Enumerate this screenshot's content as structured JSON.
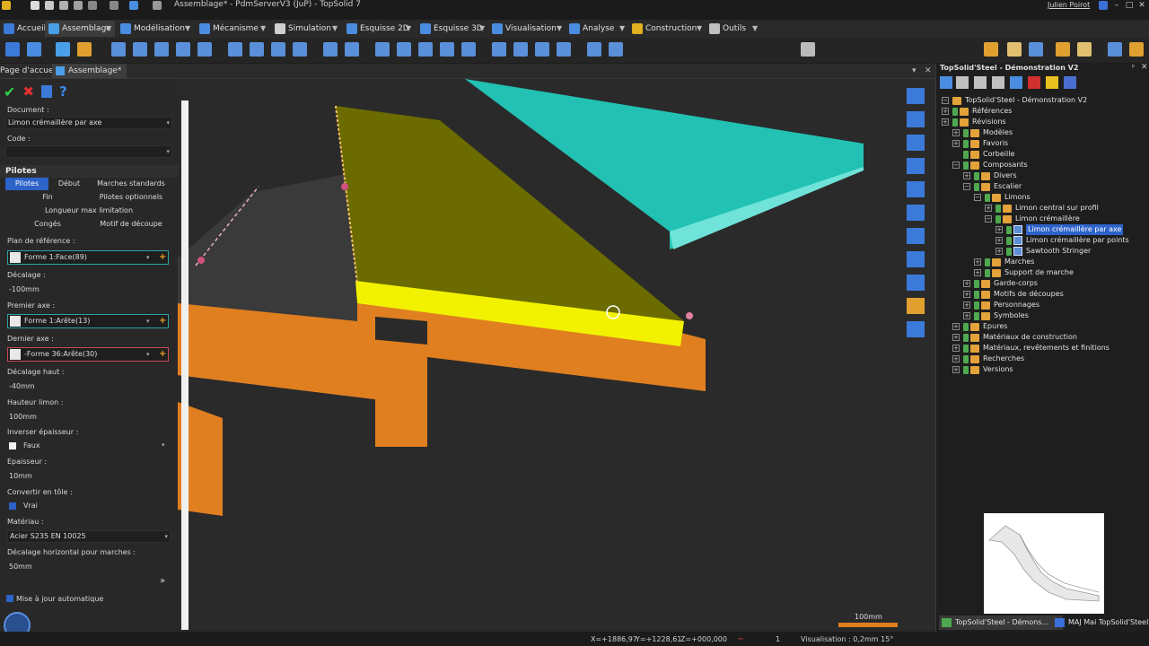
{
  "window": {
    "title": "Assemblage* - PdmServerV3 (JuP) - TopSolid 7",
    "user": "Julien Poirot",
    "minimize": "–",
    "maximize": "□",
    "close": "✕"
  },
  "menu": {
    "items": [
      {
        "label": "Accueil"
      },
      {
        "label": "Assemblage"
      },
      {
        "label": "Modélisation"
      },
      {
        "label": "Mécanisme"
      },
      {
        "label": "Simulation"
      },
      {
        "label": "Esquisse 2D"
      },
      {
        "label": "Esquisse 3D"
      },
      {
        "label": "Visualisation"
      },
      {
        "label": "Analyse"
      },
      {
        "label": "Construction"
      },
      {
        "label": "Outils"
      }
    ],
    "caret": "▼"
  },
  "tabs": {
    "home": "Page d'accueil",
    "assembly": "Assemblage*",
    "pin": "▾",
    "close": "✕"
  },
  "panel": {
    "ok_icon": "✔",
    "cancel_icon": "✖",
    "help_icon": "?",
    "document_label": "Document :",
    "document_value": "Limon crémaillère par axe",
    "code_label": "Code :",
    "code_value": "",
    "section_title": "Pilotes",
    "pilot_tabs": [
      "Pilotes",
      "Début",
      "Marches standards",
      "Fin",
      "Pilotes optionnels",
      "Longueur max limitation",
      "Congés",
      "Motif de découpe"
    ],
    "plan_label": "Plan de référence :",
    "plan_value": "Forme 1:Face(89)",
    "offset_label": "Décalage :",
    "offset_value": "-100mm",
    "first_axis_label": "Premier axe :",
    "first_axis_value": "Forme 1:Arête(13)",
    "last_axis_label": "Dernier axe :",
    "last_axis_value": "-Forme 36:Arête(30)",
    "top_offset_label": "Décalage haut :",
    "top_offset_value": "-40mm",
    "height_label": "Hauteur limon :",
    "height_value": "100mm",
    "invert_label": "Inverser épaisseur :",
    "invert_value": "Faux",
    "thickness_label": "Epaisseur :",
    "thickness_value": "10mm",
    "sheet_label": "Convertir en tôle :",
    "sheet_value": "Vrai",
    "material_label": "Matériau :",
    "material_value": "Acier S235 EN 10025",
    "h_offset_label": "Décalage horizontal pour marches :",
    "h_offset_value": "50mm",
    "more": "»",
    "auto_update": "Mise à jour automatique",
    "dropdown": "▾",
    "plus": "+"
  },
  "viewport": {
    "scale_label": "100mm",
    "colors": {
      "olive": "#6f6f00",
      "yellow": "#f5f500",
      "orange": "#e08020",
      "cyan": "#23c4b8",
      "gray": "#3c3c3c"
    }
  },
  "tree": {
    "title": "TopSolid'Steel - Démonstration V2",
    "pin": "ᵖ",
    "close": "✕",
    "expand": "+",
    "collapse": "−",
    "items": [
      {
        "label": "TopSolid'Steel - Démonstration V2",
        "depth": 0,
        "exp": "−",
        "kind": "root"
      },
      {
        "label": "Références",
        "depth": 0,
        "exp": "+",
        "kind": "folder"
      },
      {
        "label": "Révisions",
        "depth": 0,
        "exp": "+",
        "kind": "folder"
      },
      {
        "label": "Modèles",
        "depth": 1,
        "exp": "+",
        "kind": "folder"
      },
      {
        "label": "Favoris",
        "depth": 1,
        "exp": "+",
        "kind": "folder"
      },
      {
        "label": "Corbeille",
        "depth": 1,
        "exp": "",
        "kind": "folder"
      },
      {
        "label": "Composants",
        "depth": 1,
        "exp": "−",
        "kind": "folder"
      },
      {
        "label": "Divers",
        "depth": 2,
        "exp": "+",
        "kind": "folder"
      },
      {
        "label": "Escalier",
        "depth": 2,
        "exp": "−",
        "kind": "folder"
      },
      {
        "label": "Limons",
        "depth": 3,
        "exp": "−",
        "kind": "folder"
      },
      {
        "label": "Limon central sur profil",
        "depth": 4,
        "exp": "+",
        "kind": "folder"
      },
      {
        "label": "Limon crémaillère",
        "depth": 4,
        "exp": "−",
        "kind": "folder"
      },
      {
        "label": "Limon crémaillère par axe",
        "depth": 5,
        "exp": "+",
        "kind": "part",
        "selected": true
      },
      {
        "label": "Limon crémaillère par points",
        "depth": 5,
        "exp": "+",
        "kind": "part"
      },
      {
        "label": "Sawtooth Stringer",
        "depth": 5,
        "exp": "+",
        "kind": "part"
      },
      {
        "label": "Marches",
        "depth": 3,
        "exp": "+",
        "kind": "folder"
      },
      {
        "label": "Support de marche",
        "depth": 3,
        "exp": "+",
        "kind": "folder"
      },
      {
        "label": "Garde-corps",
        "depth": 2,
        "exp": "+",
        "kind": "folder"
      },
      {
        "label": "Motifs de découpes",
        "depth": 2,
        "exp": "+",
        "kind": "folder"
      },
      {
        "label": "Personnages",
        "depth": 2,
        "exp": "+",
        "kind": "folder"
      },
      {
        "label": "Symboles",
        "depth": 2,
        "exp": "+",
        "kind": "folder"
      },
      {
        "label": "Epures",
        "depth": 1,
        "exp": "+",
        "kind": "folder"
      },
      {
        "label": "Matériaux de construction",
        "depth": 1,
        "exp": "+",
        "kind": "folder"
      },
      {
        "label": "Matériaux, revêtements et finitions",
        "depth": 1,
        "exp": "+",
        "kind": "folder"
      },
      {
        "label": "Recherches",
        "depth": 1,
        "exp": "+",
        "kind": "folder"
      },
      {
        "label": "Versions",
        "depth": 1,
        "exp": "+",
        "kind": "folder"
      }
    ]
  },
  "bottom_tabs": {
    "left": "TopSolid'Steel - Démons...",
    "right": "MAJ Mai TopSolid'Steel"
  },
  "status": {
    "x": "X=+1886,97",
    "y": "Y=+1228,61",
    "z": "Z=+000,000",
    "count": "1",
    "visualisation": "Visualisation : 0,2mm 15°"
  }
}
